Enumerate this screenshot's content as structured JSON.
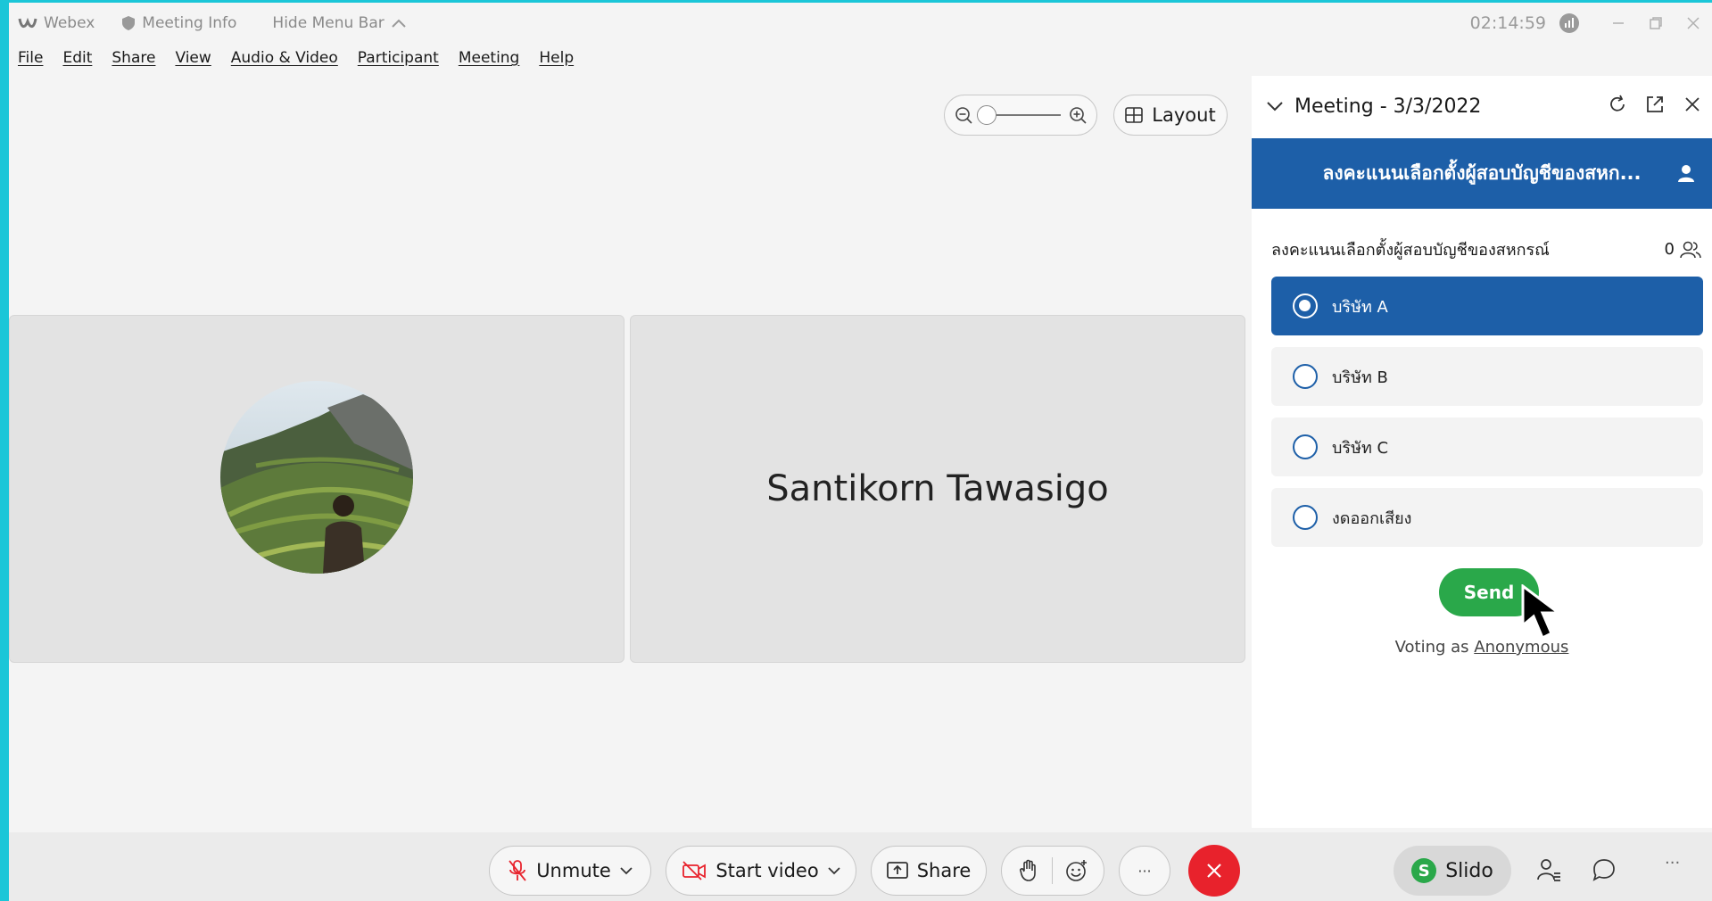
{
  "titlebar": {
    "app_name": "Webex",
    "meeting_info": "Meeting Info",
    "hide_menu": "Hide Menu Bar",
    "clock": "02:14:59"
  },
  "menu": [
    "File",
    "Edit",
    "Share",
    "View",
    "Audio & Video",
    "Participant",
    "Meeting",
    "Help"
  ],
  "controls": {
    "layout_label": "Layout"
  },
  "tiles": {
    "participant_name": "Santikorn Tawasigo"
  },
  "panel": {
    "title": "Meeting - 3/3/2022",
    "banner": "ลงคะแนนเลือกตั้งผู้สอบบัญชีของสหก...",
    "question": "ลงคะแนนเลือกตั้งผู้สอบบัญชีของสหกรณ์",
    "count": "0",
    "options": [
      {
        "label": "บริษัท A",
        "selected": true
      },
      {
        "label": "บริษัท B",
        "selected": false
      },
      {
        "label": "บริษัท C",
        "selected": false
      },
      {
        "label": "งดออกเสียง",
        "selected": false
      }
    ],
    "send_label": "Send",
    "voting_prefix": "Voting as",
    "voting_name": "Anonymous"
  },
  "bottombar": {
    "unmute": "Unmute",
    "start_video": "Start video",
    "share": "Share",
    "slido": "Slido",
    "more": "···"
  },
  "colors": {
    "accent": "#1d5fa8",
    "send": "#2aa84a",
    "end_call": "#e8222c"
  }
}
